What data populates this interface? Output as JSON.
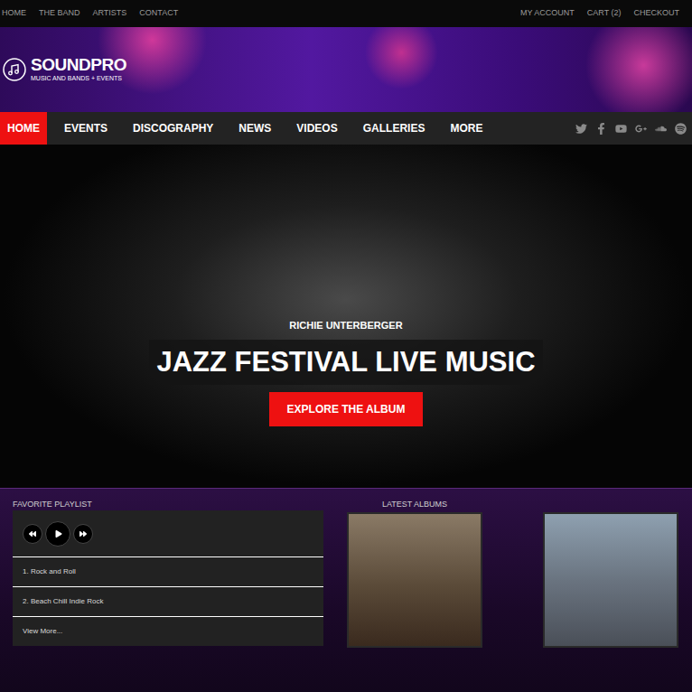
{
  "top_links": [
    "HOME",
    "THE BAND",
    "ARTISTS",
    "CONTACT"
  ],
  "account_links": [
    "MY ACCOUNT",
    "CART (2)",
    "CHECKOUT"
  ],
  "logo": {
    "title": "SOUNDPRO",
    "tagline": "MUSIC AND BANDS + EVENTS"
  },
  "nav": [
    {
      "label": "HOME",
      "selected": true
    },
    {
      "label": "EVENTS",
      "selected": false
    },
    {
      "label": "DISCOGRAPHY",
      "selected": false
    },
    {
      "label": "NEWS",
      "selected": false
    },
    {
      "label": "VIDEOS",
      "selected": false
    },
    {
      "label": "GALLERIES",
      "selected": false
    },
    {
      "label": "MORE",
      "selected": false
    }
  ],
  "hero": {
    "artist": "RICHIE UNTERBERGER",
    "title": "JAZZ FESTIVAL LIVE MUSIC",
    "button": "EXPLORE THE ALBUM"
  },
  "playlist": {
    "heading": "FAVORITE PLAYLIST",
    "tracks": [
      "1. Rock and Roll",
      "2. Beach Chill Indie Rock"
    ],
    "more": "View More..."
  },
  "albums": {
    "heading": "LATEST ALBUMS"
  }
}
